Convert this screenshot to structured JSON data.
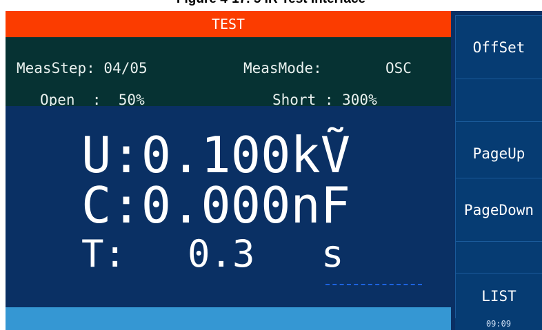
{
  "caption": "Figure 4-17. 5 IR Test Interface",
  "title": "TEST",
  "info": {
    "meas_step_label": "MeasStep: 04/05",
    "meas_mode_label": "MeasMode:",
    "meas_mode_value": "OSC",
    "open_label": "Open  :  50%",
    "short_label": "Short : 300%"
  },
  "readings": {
    "voltage": "U:0.100kṼ",
    "capacitance": "C:0.000nF",
    "time_label": "T:",
    "time_value": "0.3",
    "time_unit": "s"
  },
  "softkeys": {
    "k1": "OffSet",
    "k2": "",
    "k3": "PageUp",
    "k4": "PageDown",
    "k5": "",
    "k6": "LIST"
  },
  "clock": "09:09",
  "colors": {
    "title_bar": "#fb3c00",
    "info_panel": "#063233",
    "main_panel": "#0a3064",
    "status_bar": "#3597d3",
    "softkey": "#063c73"
  }
}
